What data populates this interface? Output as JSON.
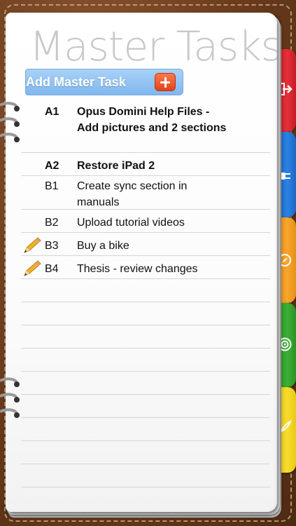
{
  "page": {
    "title": "Master Tasks"
  },
  "add_button": {
    "label": "Add Master Task",
    "icon": "plus-icon",
    "color": "#8cc0f2"
  },
  "tasks": [
    {
      "priority": "A1",
      "text": "Opus Domini Help Files - Add pictures and 2 sections",
      "bold": true,
      "pencil": false
    },
    {
      "priority": "A2",
      "text": "Restore iPad 2",
      "bold": true,
      "pencil": false
    },
    {
      "priority": "B1",
      "text": "Create sync section in manuals",
      "bold": false,
      "pencil": false
    },
    {
      "priority": "B2",
      "text": "Upload tutorial videos",
      "bold": false,
      "pencil": false
    },
    {
      "priority": "B3",
      "text": "Buy a bike",
      "bold": false,
      "pencil": true
    },
    {
      "priority": "B4",
      "text": "Thesis - review changes",
      "bold": false,
      "pencil": true
    }
  ],
  "side_tabs": [
    {
      "name": "red",
      "color": "#d9202a",
      "icon": "exit-icon"
    },
    {
      "name": "blue",
      "color": "#1f6fd0",
      "icon": "plug-icon"
    },
    {
      "name": "orange",
      "color": "#f39a1e",
      "icon": "compass-icon"
    },
    {
      "name": "green",
      "color": "#2f9a2a",
      "icon": "target-icon"
    },
    {
      "name": "yellow",
      "color": "#f4d41c",
      "icon": "feather-icon"
    }
  ]
}
